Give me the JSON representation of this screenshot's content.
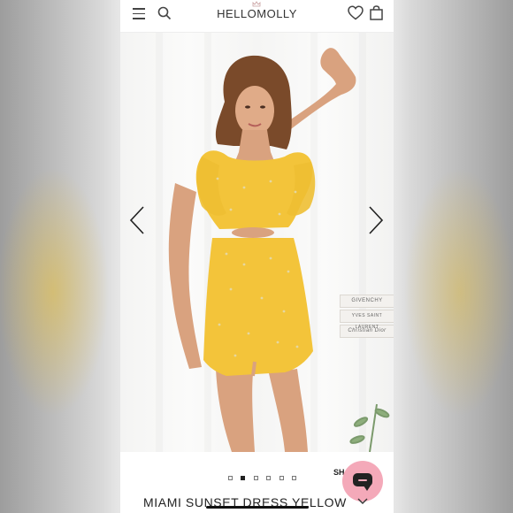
{
  "header": {
    "brand": "HELLOMOLLY",
    "menu_icon": "hamburger-menu-icon",
    "search_icon": "search-icon",
    "wishlist_icon": "heart-icon",
    "cart_icon": "shopping-bag-icon"
  },
  "gallery": {
    "prev_icon": "chevron-left-icon",
    "next_icon": "chevron-right-icon",
    "slide_count": 6,
    "active_slide": 2,
    "background_books": [
      "GIVENCHY",
      "YVES SAINT LAURENT",
      "Christian Dior"
    ]
  },
  "share": {
    "label": "SH"
  },
  "chat": {
    "icon": "chat-bubble-icon",
    "color": "#f4a9b9"
  },
  "product": {
    "title": "MIAMI SUNSET DRESS YELLOW",
    "dress_color": "#f3c43a"
  }
}
